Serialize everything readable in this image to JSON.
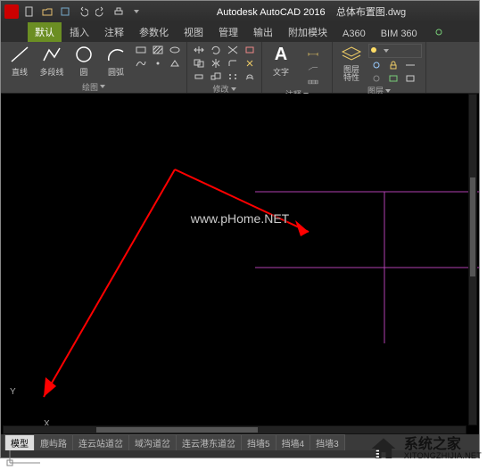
{
  "title": {
    "app": "Autodesk AutoCAD 2016",
    "file": "总体布置图.dwg"
  },
  "ribbon_tabs": [
    "默认",
    "插入",
    "注释",
    "参数化",
    "视图",
    "管理",
    "输出",
    "附加模块",
    "A360",
    "BIM 360"
  ],
  "active_tab_index": 0,
  "panels": {
    "draw": {
      "label": "绘图",
      "line_btn": "直线",
      "polyline_btn": "多段线",
      "circle_btn": "圆",
      "arc_btn": "圆弧"
    },
    "modify": {
      "label": "修改"
    },
    "annotate": {
      "label": "注释",
      "text_btn": "文字",
      "a_glyph": "A"
    },
    "layers": {
      "label": "图层",
      "props_btn": "图层\n特性"
    }
  },
  "canvas": {
    "watermark": "www.pHome.NET",
    "ucs_x": "X",
    "ucs_y": "Y"
  },
  "layout_tabs": [
    "模型",
    "鹿屿路",
    "连云站道岔",
    "域沟道岔",
    "连云港东道岔",
    "挡墙5",
    "挡墙4",
    "挡墙3"
  ],
  "active_layout_index": 0,
  "brand": {
    "name": "系统之家",
    "url": "XITONGZHIJIA.NET"
  }
}
